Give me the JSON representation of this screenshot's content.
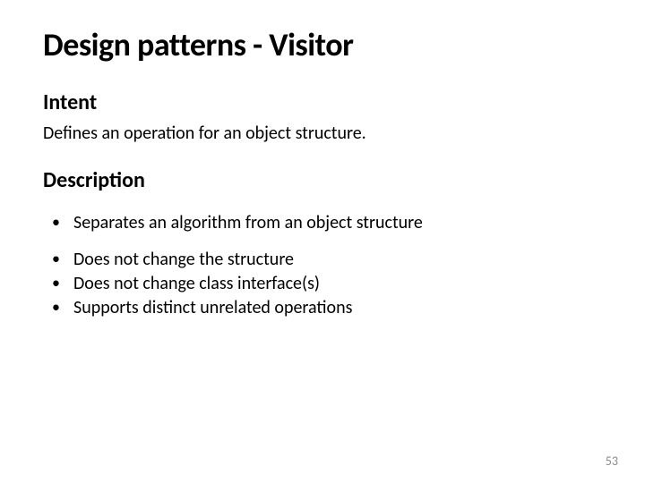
{
  "title": "Design patterns - Visitor",
  "intent": {
    "label": "Intent",
    "text": "Defines an operation for an object structure."
  },
  "description": {
    "label": "Description",
    "bullets_group1": [
      "Separates an algorithm from an object structure"
    ],
    "bullets_group2": [
      "Does not change the structure",
      "Does not change class interface(s)",
      "Supports distinct unrelated operations"
    ]
  },
  "page_number": "53"
}
